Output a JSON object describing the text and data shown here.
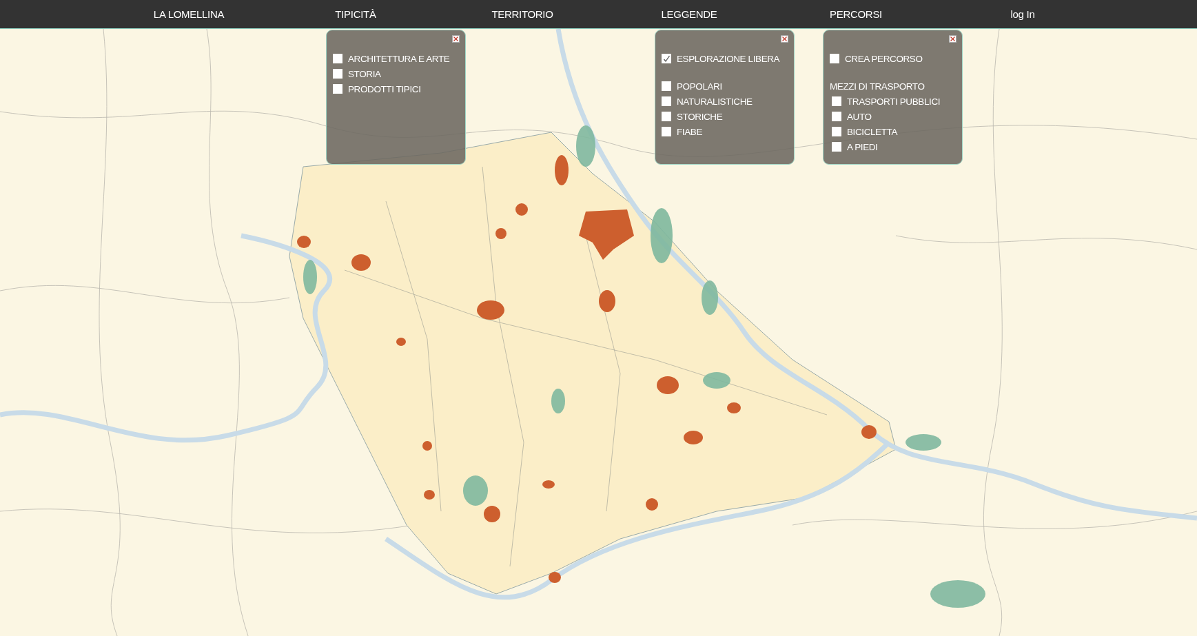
{
  "nav": [
    {
      "label": "LA LOMELLINA"
    },
    {
      "label": "TIPICITÀ"
    },
    {
      "label": "TERRITORIO"
    },
    {
      "label": "LEGGENDE"
    },
    {
      "label": "PERCORSI"
    },
    {
      "label": "log In"
    }
  ],
  "panels": [
    {
      "groups": [
        {
          "items": [
            {
              "label": "ARCHITETTURA E ARTE",
              "checked": false
            },
            {
              "label": "STORIA",
              "checked": false
            },
            {
              "label": "PRODOTTI TIPICI",
              "checked": false
            }
          ]
        }
      ]
    },
    {
      "groups": [
        {
          "items": [
            {
              "label": "ESPLORAZIONE LIBERA",
              "checked": true
            }
          ]
        },
        {
          "items": [
            {
              "label": "POPOLARI",
              "checked": false
            },
            {
              "label": "NATURALISTICHE",
              "checked": false
            },
            {
              "label": "STORICHE",
              "checked": false
            },
            {
              "label": "FIABE",
              "checked": false
            }
          ]
        }
      ]
    },
    {
      "groups": [
        {
          "items": [
            {
              "label": "CREA PERCORSO",
              "checked": false
            }
          ]
        },
        {
          "heading": "MEZZI DI TRASPORTO",
          "items": [
            {
              "label": "TRASPORTI PUBBLICI",
              "checked": false
            },
            {
              "label": "AUTO",
              "checked": false
            },
            {
              "label": "BICICLETTA",
              "checked": false
            },
            {
              "label": "A PIEDI",
              "checked": false
            }
          ]
        }
      ]
    }
  ]
}
